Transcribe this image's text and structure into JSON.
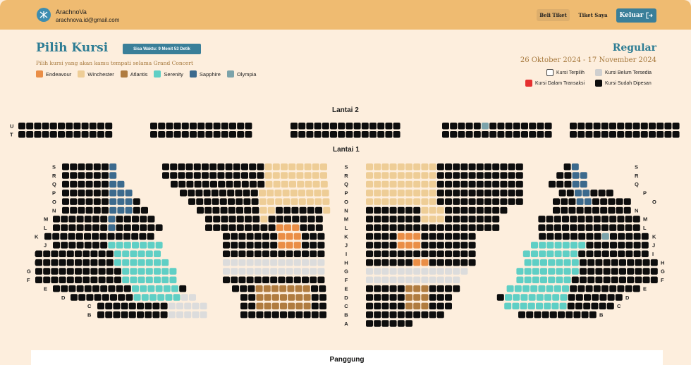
{
  "header": {
    "brand_name": "ArachnoVa",
    "brand_email": "arachnova.id@gmail.com",
    "nav": {
      "beli": "Beli Tiket",
      "tiket": "Tiket Saya",
      "keluar": "Keluar",
      "keluar_icon": "logout-icon"
    }
  },
  "page": {
    "title": "Pilih Kursi",
    "timer": "Sisa Waktu: 9 Menit 53 Detik",
    "subtitle": "Pilih kursi yang akan kamu tempati selama Grand Concert",
    "ticket_class": "Regular",
    "dates": "26 Oktober 2024 - 17 November 2024"
  },
  "zones": [
    {
      "name": "Endeavour",
      "color": "#ea8e46"
    },
    {
      "name": "Winchester",
      "color": "#eecd96"
    },
    {
      "name": "Atlantis",
      "color": "#b07c40"
    },
    {
      "name": "Serenity",
      "color": "#5fcfc5"
    },
    {
      "name": "Sapphire",
      "color": "#3c6a8d"
    },
    {
      "name": "Olympia",
      "color": "#7ca3aa"
    }
  ],
  "status_legend": {
    "terpilih": {
      "label": "Kursi Terpilih",
      "color": "#ffffff"
    },
    "belum": {
      "label": "Kursi Belum Tersedia",
      "color": "#cfcfcf"
    },
    "transaksi": {
      "label": "Kursi Dalam Transaksi",
      "color": "#e53030"
    },
    "dipesan": {
      "label": "Kursi Sudah Dipesan",
      "color": "#0d0d0d"
    }
  },
  "floors": {
    "lantai2": "Lantai 2",
    "lantai1": "Lantai 1",
    "stage": "Panggung"
  },
  "row_labels": {
    "lantai2": [
      "U",
      "T"
    ],
    "lantai1_left": [
      "S",
      "R",
      "Q",
      "P",
      "O",
      "N",
      "M",
      "L",
      "K",
      "J",
      "I",
      "H",
      "G",
      "F",
      "E",
      "D",
      "C",
      "B"
    ],
    "lantai1_center": [
      "S",
      "R",
      "Q",
      "P",
      "O",
      "N",
      "M",
      "L",
      "K",
      "J",
      "I",
      "H",
      "G",
      "F",
      "E",
      "D",
      "C",
      "B",
      "A"
    ],
    "lantai1_right": [
      "S",
      "R",
      "Q",
      "P",
      "O",
      "N",
      "M",
      "L",
      "K",
      "J",
      "I",
      "H",
      "G",
      "F",
      "E",
      "D",
      "C",
      "B"
    ]
  }
}
